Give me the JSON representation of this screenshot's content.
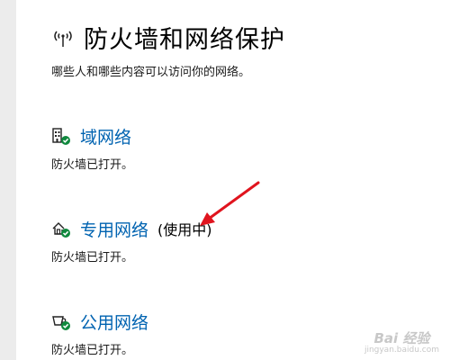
{
  "header": {
    "title": "防火墙和网络保护",
    "icon": "antenna-icon"
  },
  "subtitle": "哪些人和哪些内容可以访问你的网络。",
  "networks": [
    {
      "icon": "domain-network-icon",
      "label": "域网络",
      "status_tag": "",
      "description": "防火墙已打开。"
    },
    {
      "icon": "private-network-icon",
      "label": "专用网络",
      "status_tag": "(使用中)",
      "description": "防火墙已打开。"
    },
    {
      "icon": "public-network-icon",
      "label": "公用网络",
      "status_tag": "",
      "description": "防火墙已打开。"
    }
  ],
  "colors": {
    "link": "#0063b1",
    "check": "#10893e",
    "annotation_arrow": "#e0141e"
  },
  "watermark": {
    "logo": "Bai 经验",
    "url": "jingyan.baidu.com"
  }
}
